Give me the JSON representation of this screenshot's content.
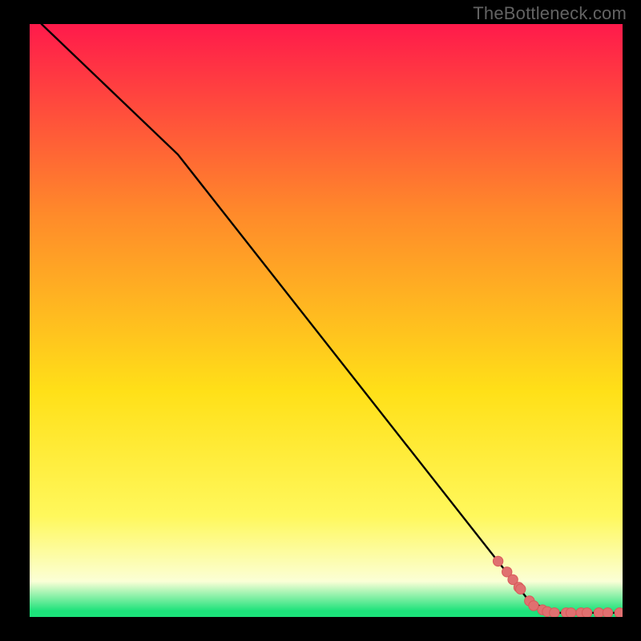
{
  "watermark": "TheBottleneck.com",
  "colors": {
    "gradient_top": "#ff1a4b",
    "gradient_mid_upper": "#ff8a2a",
    "gradient_mid": "#ffe018",
    "gradient_mid_lower": "#fff85c",
    "gradient_pale": "#fbffd6",
    "gradient_green": "#1ce27a",
    "line": "#000000",
    "marker_fill": "#e07070",
    "marker_stroke": "#d85a5a",
    "frame": "#000000"
  },
  "chart_data": {
    "type": "line",
    "title": "",
    "xlabel": "",
    "ylabel": "",
    "xlim": [
      0,
      100
    ],
    "ylim": [
      0,
      100
    ],
    "grid": false,
    "legend": false,
    "series": [
      {
        "name": "curve",
        "type": "line",
        "x": [
          2,
          25,
          84,
          88,
          100
        ],
        "y": [
          100,
          78,
          3,
          0.7,
          0.7
        ]
      },
      {
        "name": "markers",
        "type": "scatter",
        "x": [
          79,
          80.5,
          81.5,
          82.5,
          82.8,
          84.3,
          85,
          86.5,
          87.3,
          88.5,
          90.5,
          91.3,
          93,
          94,
          96,
          97.5,
          99.5
        ],
        "y": [
          9.4,
          7.6,
          6.3,
          5.0,
          4.7,
          2.7,
          1.9,
          1.2,
          0.9,
          0.7,
          0.7,
          0.7,
          0.7,
          0.7,
          0.7,
          0.7,
          0.7
        ]
      }
    ]
  }
}
